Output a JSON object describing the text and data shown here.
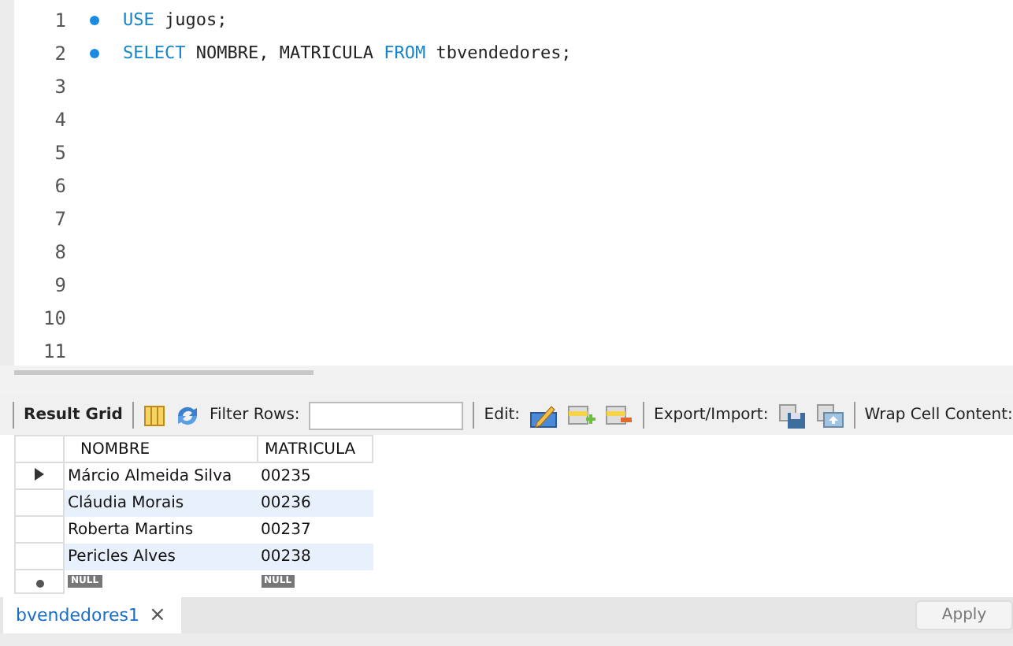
{
  "editor": {
    "lines": [
      {
        "number": "1",
        "marker": true,
        "tokens": [
          {
            "kind": "keyword",
            "text": "USE"
          },
          {
            "kind": "plain",
            "text": " jugos;"
          }
        ]
      },
      {
        "number": "2",
        "marker": true,
        "tokens": [
          {
            "kind": "keyword",
            "text": "SELECT"
          },
          {
            "kind": "plain",
            "text": " NOMBRE, MATRICULA "
          },
          {
            "kind": "keyword",
            "text": "FROM"
          },
          {
            "kind": "plain",
            "text": " tbvendedores;"
          }
        ]
      },
      {
        "number": "3",
        "marker": false
      },
      {
        "number": "4",
        "marker": false
      },
      {
        "number": "5",
        "marker": false
      },
      {
        "number": "6",
        "marker": false
      },
      {
        "number": "7",
        "marker": false
      },
      {
        "number": "8",
        "marker": false
      },
      {
        "number": "9",
        "marker": false
      },
      {
        "number": "10",
        "marker": false
      },
      {
        "number": "11",
        "marker": false
      }
    ]
  },
  "toolbar": {
    "result_grid": "Result Grid",
    "filter_label": "Filter Rows:",
    "edit_label": "Edit:",
    "export_label": "Export/Import:",
    "wrap_label": "Wrap Cell Content:"
  },
  "grid": {
    "columns": [
      "NOMBRE",
      "MATRICULA"
    ],
    "rows": [
      {
        "cells": [
          "Márcio Almeida Silva",
          "00235"
        ],
        "current": true
      },
      {
        "cells": [
          "Cláudia Morais",
          "00236"
        ],
        "current": false
      },
      {
        "cells": [
          "Roberta Martins",
          "00237"
        ],
        "current": false
      },
      {
        "cells": [
          "Pericles Alves",
          "00238"
        ],
        "current": false
      }
    ],
    "new_row": [
      "NULL",
      "NULL"
    ]
  },
  "result_tab": {
    "label": "bvendedores1",
    "close": "×"
  },
  "apply_button": "Apply"
}
